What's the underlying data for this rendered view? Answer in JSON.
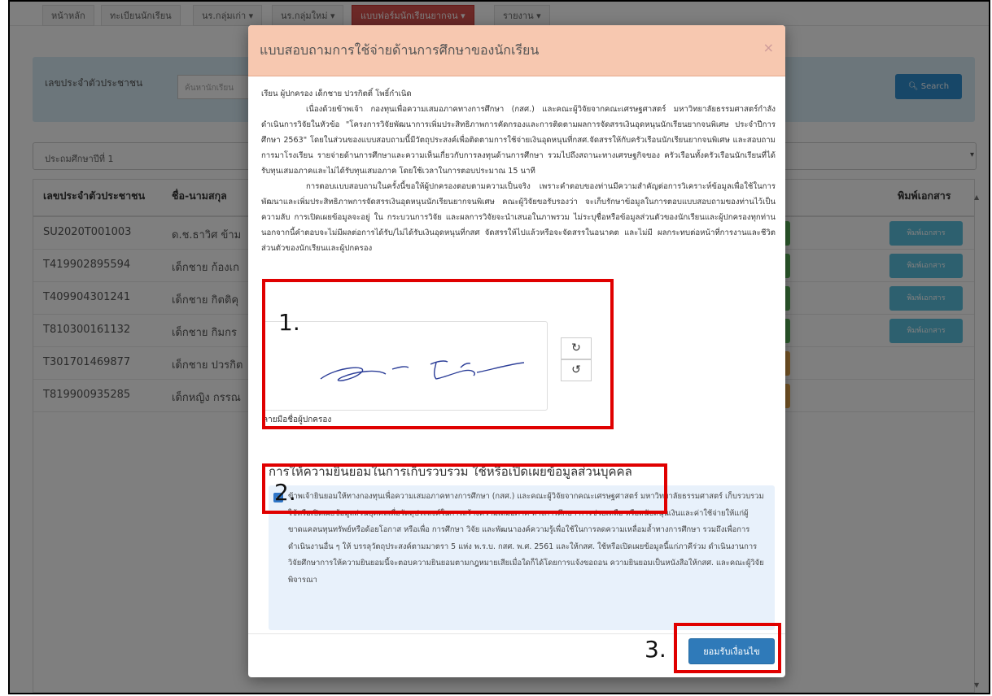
{
  "nav": {
    "items": [
      "หน้าหลัก",
      "ทะเบียนนักเรียน",
      "นร.กลุ่มเก่า ▾",
      "นร.กลุ่มใหม่ ▾",
      "แบบฟอร์มนักเรียนยากจน ▾",
      "รายงาน ▾"
    ]
  },
  "search": {
    "label": "เลขประจำตัวประชาชน",
    "placeholder": "ค้นหานักเรียน",
    "button": "Search",
    "button_icon": "search-icon"
  },
  "semester": {
    "value": "ประถมศึกษาปีที่ 1"
  },
  "table": {
    "headers": {
      "id": "เลขประจำตัวประชาชน",
      "name": "ชื่อ-นามสกุล",
      "print": "พิมพ์เอกสาร"
    },
    "print_label": "พิมพ์เอกสาร",
    "rows": [
      {
        "id": "SU2020T001003",
        "name": "ด.ช.ธาวิศ ข้าม"
      },
      {
        "id": "T419902895594",
        "name": "เด็กชาย ก้องเก"
      },
      {
        "id": "T409904301241",
        "name": "เด็กชาย กิตติคุ"
      },
      {
        "id": "T810300161132",
        "name": "เด็กชาย กิมกร"
      },
      {
        "id": "T301701469877",
        "name": "เด็กชาย ปวรกิต"
      },
      {
        "id": "T819900935285",
        "name": "เด็กหญิง กรรณ"
      }
    ]
  },
  "modal": {
    "title": "แบบสอบถามการใช้จ่ายด้านการศึกษาของนักเรียน",
    "close": "×",
    "greeting": "เรียน ผู้ปกครอง เด็กชาย ปวรกิตติ์ โพธิ์กำเนิด",
    "para1": "เนื่องด้วยข้าพเจ้า กองทุนเพื่อความเสมอภาคทางการศึกษา (กสศ.) และคณะผู้วิจัยจากคณะเศรษฐศาสตร์ มหาวิทยาลัยธรรมศาสตร์กำลังดำเนินการวิจัยในหัวข้อ \"โครงการวิจัยพัฒนาการเพิ่มประสิทธิภาพการคัดกรองและการติดตามผลการจัดสรรเงินอุดหนุนนักเรียนยากจนพิเศษ ประจำปีการศึกษา 2563\" โดยในส่วนของแบบสอบถามนี้มีวัตถุประสงค์เพื่อติดตามการใช้จ่ายเงินอุดหนุนที่กสศ.จัดสรรให้กับครัวเรือนนักเรียนยากจนพิเศษ และสอบถามการมาโรงเรียน รายจ่ายด้านการศึกษาและความเห็นเกี่ยวกับการลงทุนด้านการศึกษา รวมไปถึงสถานะทางเศรษฐกิจของ ครัวเรือนทั้งครัวเรือนนักเรียนที่ได้รับทุนเสมอภาคและไม่ได้รับทุนเสมอภาค โดยใช้เวลาในการตอบประมาณ 15 นาที",
    "para2": "การตอบแบบสอบถามในครั้งนี้ขอให้ผู้ปกครองตอบตามความเป็นจริง เพราะคำตอบของท่านมีความสำคัญต่อการวิเคราะห์ข้อมูลเพื่อใช้ในการพัฒนาและเพิ่มประสิทธิภาพการจัดสรรเงินอุดหนุนนักเรียนยากจนพิเศษ คณะผู้วิจัยขอรับรองว่า จะเก็บรักษาข้อมูลในการตอบแบบสอบถามของท่านไว้เป็นความลับ การเปิดเผยข้อมูลจะอยู่ ใน กระบวนการวิจัย และผลการวิจัยจะนำเสนอในภาพรวม ไม่ระบุชื่อหรือข้อมูลส่วนตัวของนักเรียนและผู้ปกครองทุกท่าน นอกจากนี้คำตอบจะไม่มีผลต่อการได้รับ/ไม่ได้รับเงินอุดหนุนที่กสศ จัดสรรให้ไปแล้วหรือจะจัดสรรในอนาคต และไม่มี ผลกระทบต่อหน้าที่การงานและชีวิตส่วนตัวของนักเรียนและผู้ปกครอง",
    "signature_label": "ลายมือชื่อผู้ปกครอง",
    "redo_icon": "redo-icon",
    "undo_icon": "undo-icon",
    "consent_title": "การให้ความยินยอมในการเก็บรวบรวม ใช้หรือเปิดเผยข้อมูลส่วนบุคคล",
    "consent_text": "ข้าพเจ้ายินยอมให้ทางกองทุนเพื่อความเสมอภาคทางการศึกษา (กสศ.) และคณะผู้วิจัยจากคณะเศรษฐศาสตร์ มหาวิทยาลัยธรรมศาสตร์ เก็บรวบรวม ใช้หรือเปิดเผยข้อมูลส่วนบุคคลเพื่อวัตถุประสงค์ในการสร้างความเสมอภาค ทางการศึกษา การช่วยเหลือ หรือสนับสนุนเงินและค่าใช้จ่ายให้แก่ผู้ขาดแคลนทุนทรัพย์หรือด้อยโอกาส หรือเพื่อ การศึกษา วิจัย และพัฒนาองค์ความรู้เพื่อใช้ในการลดความเหลื่อมล้ำทางการศึกษา รวมถึงเพื่อการดำเนินงานอื่น ๆ ให้ บรรลุวัตถุประสงค์ตามมาตรา 5 แห่ง พ.ร.บ. กสศ. พ.ศ. 2561 และให้กสศ. ใช้หรือเปิดเผยข้อมูลนี้แก่ภาคีร่วม ดำเนินงานการวิจัยศึกษาการให้ความยินยอมนี้จะตอบความยินยอมตามกฎหมายเสียเมื่อใดก็ได้โดยการแจ้งขอถอน ความยินยอมเป็นหนังสือให้กสศ. และคณะผู้วิจัย พิจารณา",
    "accept_button": "ยอมรับเงื่อนไข"
  },
  "annotations": {
    "n1": "1.",
    "n2": "2.",
    "n3": "3."
  },
  "colors": {
    "annotation": "#e00000",
    "header": "#f7c8b0",
    "primary": "#2f7ab9",
    "info": "#5bc0de"
  }
}
